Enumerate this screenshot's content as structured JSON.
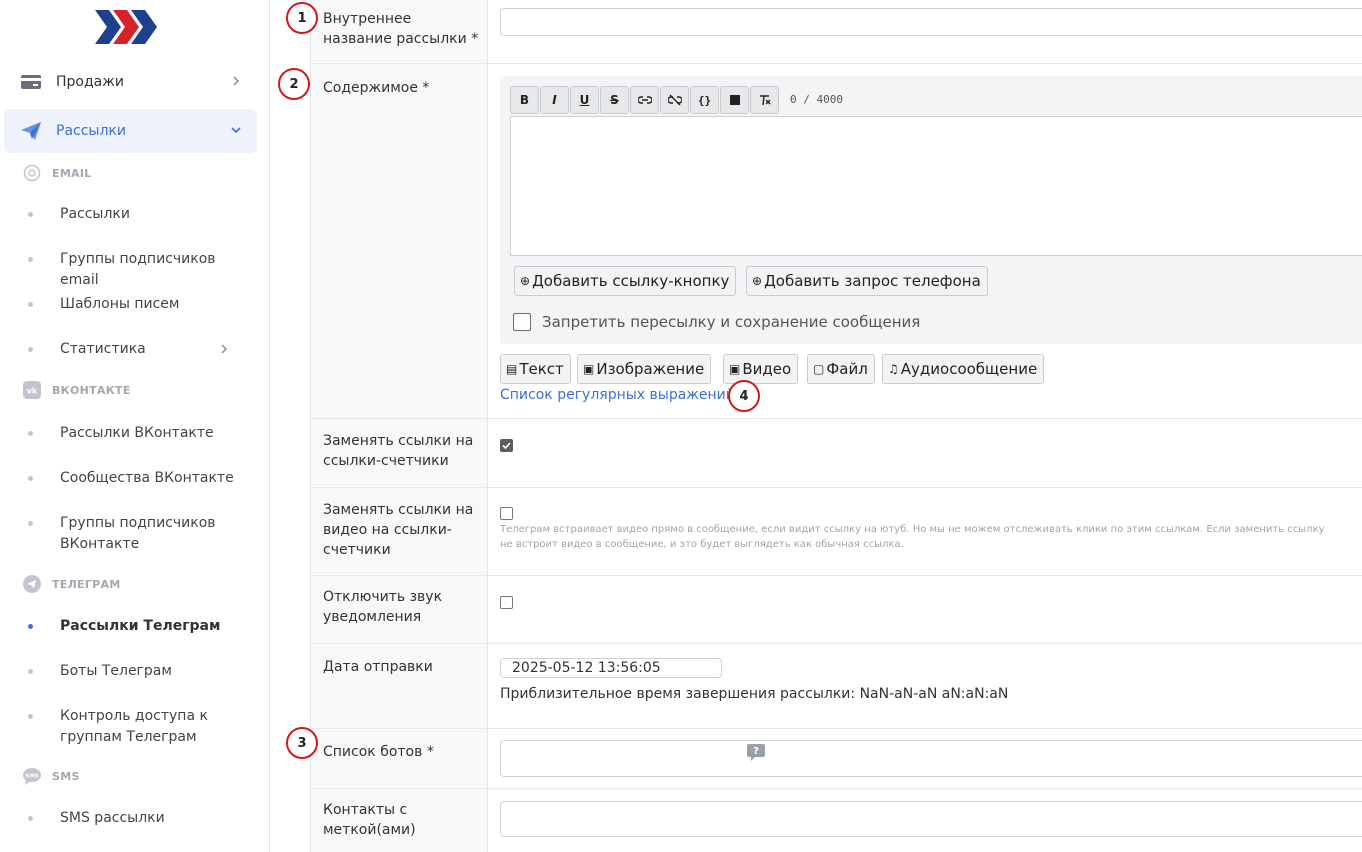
{
  "sidebar": {
    "nav": [
      {
        "label": "Продажи",
        "icon": "card-icon"
      },
      {
        "label": "Рассылки",
        "icon": "paper-plane-icon"
      }
    ],
    "sections": {
      "email": "EMAIL",
      "vk": "ВКОНТАКТЕ",
      "telegram": "ТЕЛЕГРАМ",
      "sms": "SMS"
    },
    "items": {
      "email_mailings": "Рассылки",
      "email_groups": "Группы подписчиков email",
      "email_templates": "Шаблоны писем",
      "email_stats": "Статистика",
      "vk_mailings": "Рассылки ВКонтакте",
      "vk_communities": "Сообщества ВКонтакте",
      "vk_groups": "Группы подписчиков ВКонтакте",
      "tg_mailings": "Рассылки Телеграм",
      "tg_bots": "Боты Телеграм",
      "tg_access": "Контроль доступа к группам Телеграм",
      "sms_mailings": "SMS рассылки"
    },
    "active_item": "Рассылки Телеграм"
  },
  "form": {
    "internal_name": {
      "label": "Внутреннее название рассылки *",
      "value": ""
    },
    "content": {
      "label": "Содержимое *",
      "toolbar": [
        "B",
        "I",
        "U",
        "S",
        "link",
        "unlink",
        "{}",
        "block",
        "clear"
      ],
      "counter": "0 / 4000",
      "text": "",
      "add_link_button": "Добавить ссылку-кнопку",
      "add_phone_button": "Добавить запрос телефона",
      "forbid_forward_label": "Запретить пересылку и сохранение сообщения",
      "forbid_forward_checked": false,
      "type_buttons": [
        "Текст",
        "Изображение",
        "Видео",
        "Файл",
        "Аудиосообщение"
      ],
      "regex_link": "Список регулярных выражений"
    },
    "replace_links": {
      "label": "Заменять ссылки на ссылки-счетчики",
      "checked": true
    },
    "replace_video_links": {
      "label": "Заменять ссылки на видео на ссылки-счетчики",
      "checked": false,
      "note_line1": "Телеграм встраивает видео прямо в сообщение, если видит ссылку на ютуб. Но мы не можем отслеживать клики по этим ссылкам. Если заменить ссылку",
      "note_line2": "не встроит видео в сообщение, и это будет выглядеть как обычная ссылка."
    },
    "silent": {
      "label": "Отключить звук уведомления",
      "checked": false
    },
    "send_date": {
      "label": "Дата отправки",
      "value": "2025-05-12 13:56:05",
      "eta": "Приблизительное время завершения рассылки: NaN-aN-aN aN:aN:aN"
    },
    "bots": {
      "label": "Список ботов *",
      "value": ""
    },
    "contacts": {
      "label": "Контакты с меткой(ами)",
      "value": ""
    }
  },
  "markers": [
    "1",
    "2",
    "3",
    "4"
  ],
  "colors": {
    "accent": "#3d6fd8",
    "marker": "#d11919",
    "logo_blue": "#1f3f8f",
    "logo_red": "#d6232a"
  }
}
